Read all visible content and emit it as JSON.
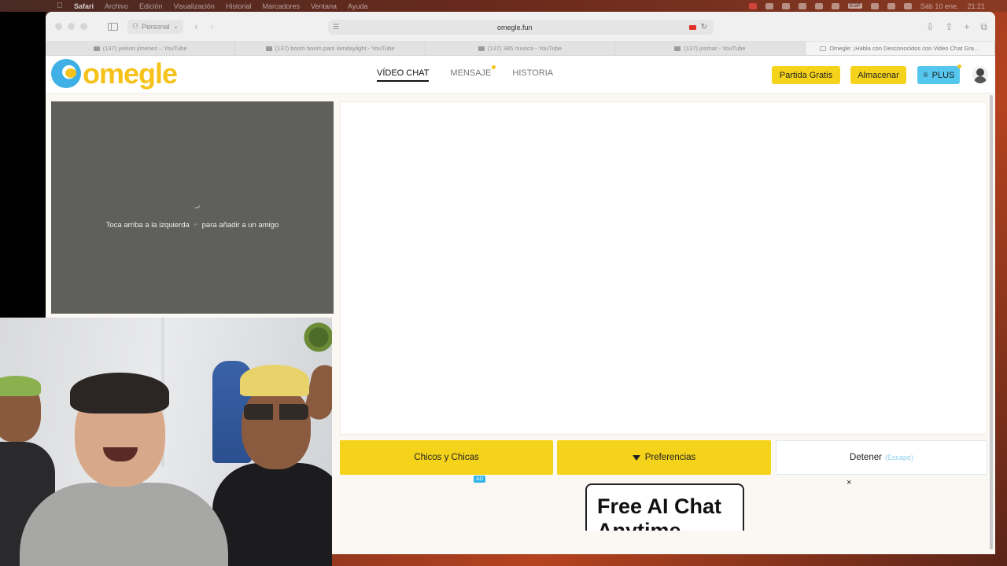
{
  "menubar": {
    "app": "Safari",
    "items": [
      "Archivo",
      "Edición",
      "Visualización",
      "Historial",
      "Marcadores",
      "Ventana",
      "Ayuda"
    ],
    "date": "Sáb 10 ene.",
    "time": "21:21",
    "keyboard": "ESP"
  },
  "browser": {
    "profile": "Personal",
    "url": "omegle.fun",
    "tabs": [
      {
        "title": "(137) yeison jimenez – YouTube",
        "active": false
      },
      {
        "title": "(137) boom boom pam iamdaylight - YouTube",
        "active": false
      },
      {
        "title": "(137) 385 musica - YouTube",
        "active": false
      },
      {
        "title": "(137) josmar - YouTube",
        "active": false
      },
      {
        "title": "Omegle: ¡Habla con Desconocidos con Video Chat Gra…",
        "active": true
      }
    ]
  },
  "site": {
    "logo": "omegle",
    "nav": [
      {
        "label": "VÍDEO CHAT",
        "active": true
      },
      {
        "label": "MENSAJE",
        "active": false,
        "dot": true
      },
      {
        "label": "HISTORIA",
        "active": false
      }
    ],
    "buttons": {
      "partida": "Partida Gratis",
      "almacenar": "Almacenar",
      "plus": "PLUS"
    },
    "hint_before": "Toca arriba a la izquierda",
    "hint_after": "para añadir a un amigo",
    "actions": {
      "gender": "Chicos y Chicas",
      "preferences": "Preferencias",
      "stop": "Detener",
      "stop_key": "(Escape)"
    },
    "ad": {
      "badge": "AD",
      "close": "×",
      "title": "Free AI Chat",
      "subtitle": "Anytime"
    }
  },
  "colors": {
    "brand_yellow": "#f6d31b",
    "brand_blue": "#55c7ee",
    "panel_gray": "#5f605b"
  }
}
